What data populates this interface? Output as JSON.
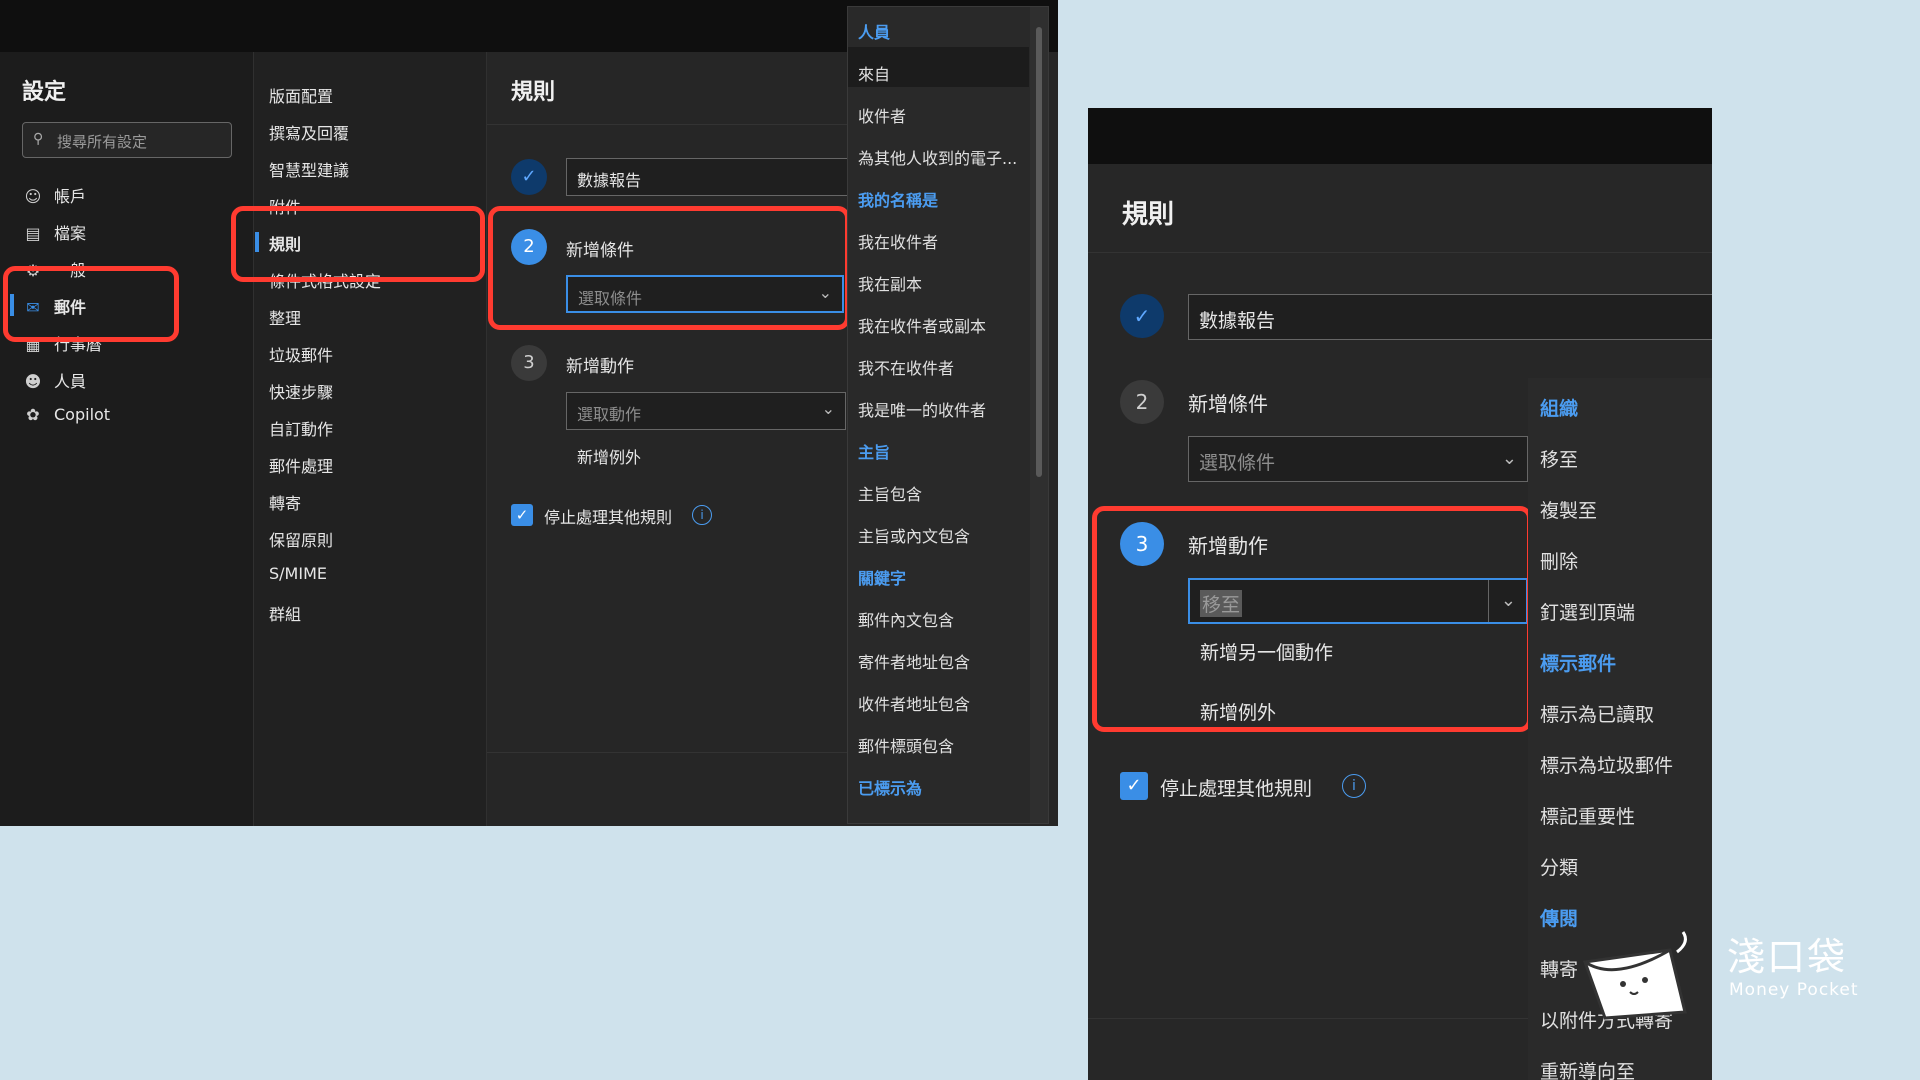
{
  "left": {
    "settings_title": "設定",
    "search_placeholder": "搜尋所有設定",
    "nav": [
      {
        "label": "帳戶",
        "icon": "person-icon"
      },
      {
        "label": "檔案",
        "icon": "file-icon"
      },
      {
        "label": "一般",
        "icon": "gear-icon"
      },
      {
        "label": "郵件",
        "icon": "mail-icon"
      },
      {
        "label": "行事曆",
        "icon": "calendar-icon"
      },
      {
        "label": "人員",
        "icon": "people-icon"
      },
      {
        "label": "Copilot",
        "icon": "copilot-icon"
      }
    ],
    "sub_nav": [
      "版面配置",
      "撰寫及回覆",
      "智慧型建議",
      "附件",
      "規則",
      "條件式格式設定",
      "整理",
      "垃圾郵件",
      "快速步驟",
      "自訂動作",
      "郵件處理",
      "轉寄",
      "保留原則",
      "S/MIME",
      "群組"
    ],
    "rules_title": "規則",
    "rule_name": "數據報告",
    "step2_label": "新增條件",
    "step2_num": "2",
    "step3_label": "新增動作",
    "step3_num": "3",
    "condition_placeholder": "選取條件",
    "action_placeholder": "選取動作",
    "add_exception": "新增例外",
    "stop_processing": "停止處理其他規則",
    "dropdown": [
      {
        "text": "人員",
        "head": true
      },
      {
        "text": "來自",
        "head": false
      },
      {
        "text": "收件者",
        "head": false
      },
      {
        "text": "為其他人收到的電子...",
        "head": false
      },
      {
        "text": "我的名稱是",
        "head": true
      },
      {
        "text": "我在收件者",
        "head": false
      },
      {
        "text": "我在副本",
        "head": false
      },
      {
        "text": "我在收件者或副本",
        "head": false
      },
      {
        "text": "我不在收件者",
        "head": false
      },
      {
        "text": "我是唯一的收件者",
        "head": false
      },
      {
        "text": "主旨",
        "head": true
      },
      {
        "text": "主旨包含",
        "head": false
      },
      {
        "text": "主旨或內文包含",
        "head": false
      },
      {
        "text": "關鍵字",
        "head": true
      },
      {
        "text": "郵件內文包含",
        "head": false
      },
      {
        "text": "寄件者地址包含",
        "head": false
      },
      {
        "text": "收件者地址包含",
        "head": false
      },
      {
        "text": "郵件標頭包含",
        "head": false
      },
      {
        "text": "已標示為",
        "head": true
      }
    ]
  },
  "right": {
    "rules_title": "規則",
    "rule_name": "數據報告",
    "step2_num": "2",
    "step2_label": "新增條件",
    "condition_placeholder": "選取條件",
    "step3_num": "3",
    "step3_label": "新增動作",
    "action_value": "移至",
    "add_another_action": "新增另一個動作",
    "add_exception": "新增例外",
    "stop_processing": "停止處理其他規則",
    "dropdown": [
      {
        "text": "組織",
        "head": true
      },
      {
        "text": "移至",
        "head": false
      },
      {
        "text": "複製至",
        "head": false
      },
      {
        "text": "刪除",
        "head": false
      },
      {
        "text": "釘選到頂端",
        "head": false
      },
      {
        "text": "標示郵件",
        "head": true
      },
      {
        "text": "標示為已讀取",
        "head": false
      },
      {
        "text": "標示為垃圾郵件",
        "head": false
      },
      {
        "text": "標記重要性",
        "head": false
      },
      {
        "text": "分類",
        "head": false
      },
      {
        "text": "傳閱",
        "head": true
      },
      {
        "text": "轉寄",
        "head": false
      },
      {
        "text": "以附件方式轉寄",
        "head": false
      },
      {
        "text": "重新導向至",
        "head": false
      }
    ]
  },
  "watermark": {
    "brand": "淺口袋",
    "brand_en": "Money Pocket"
  },
  "colors": {
    "highlight": "#ff3b30",
    "accent": "#3a8ee6",
    "heading": "#4b9cf0"
  }
}
